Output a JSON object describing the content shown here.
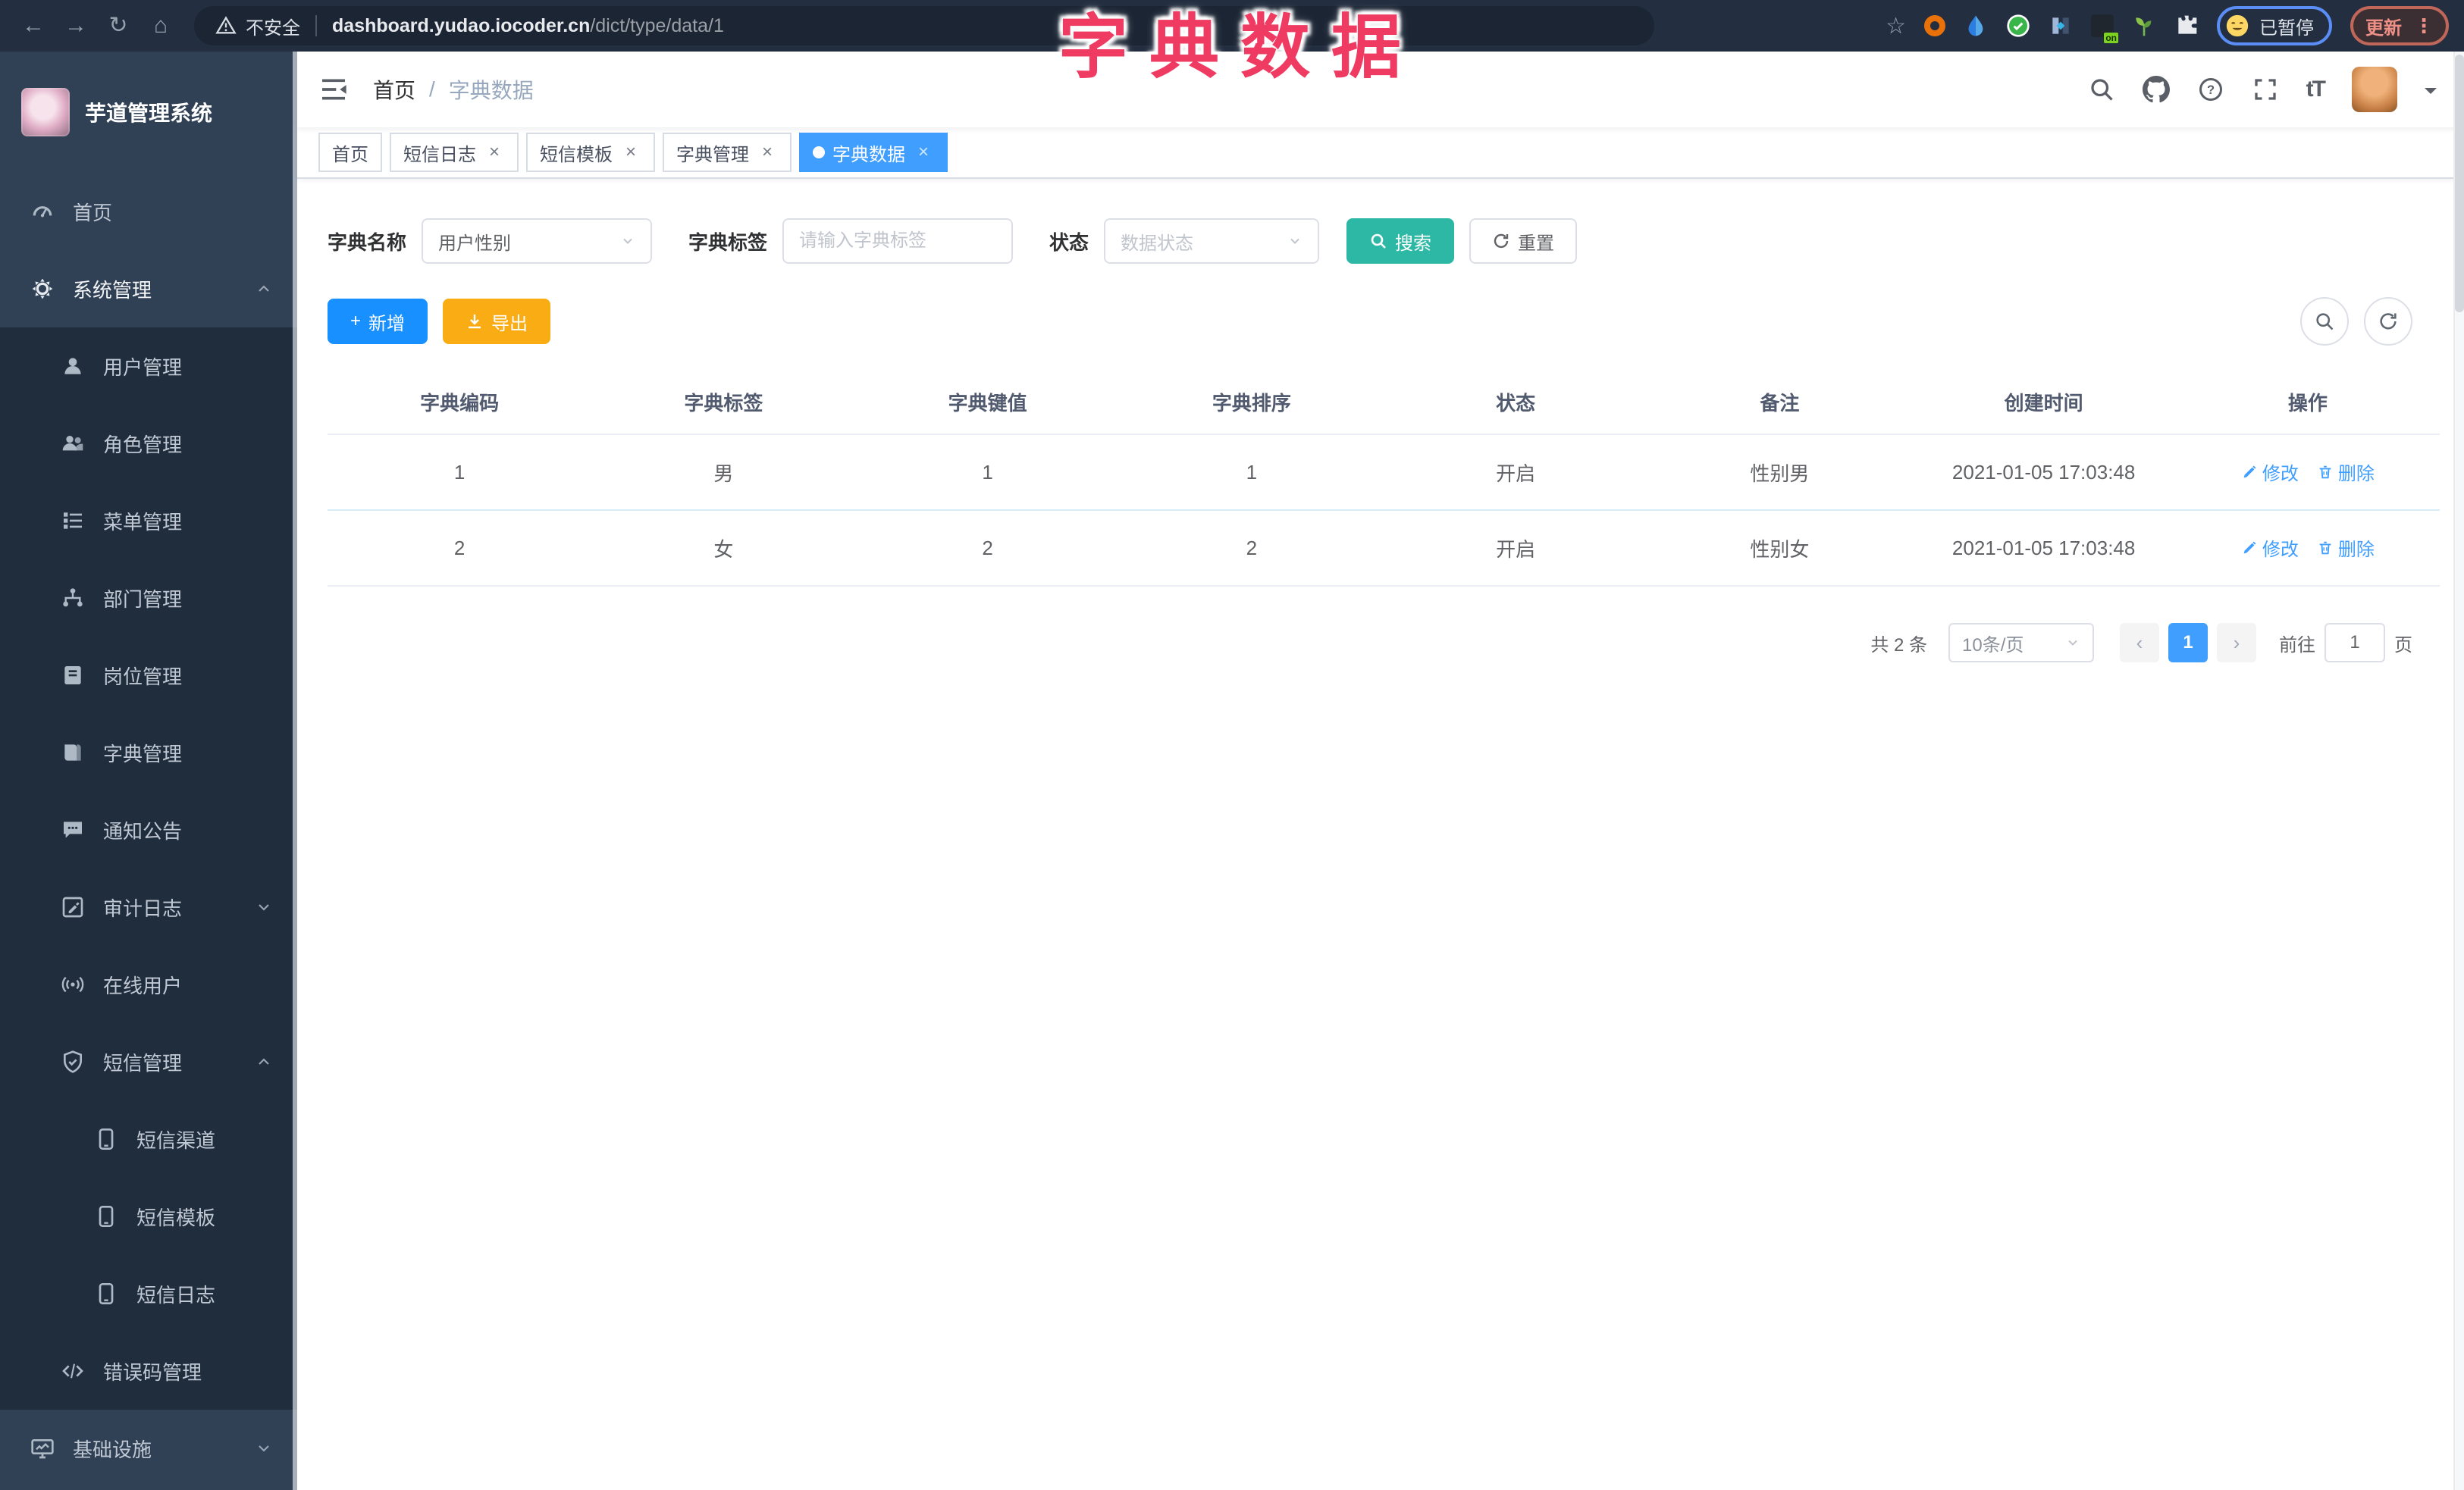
{
  "browser": {
    "security_label": "不安全",
    "url_host": "dashboard.yudao.iocoder.cn",
    "url_path": "/dict/type/data/1",
    "ext_badge_on": "on",
    "paused_label": "已暂停",
    "update_label": "更新"
  },
  "overlay_title": "字典数据",
  "sidebar": {
    "logo_title": "芋道管理系统",
    "items": [
      {
        "id": "home",
        "label": "首页",
        "icon": "dashboard-icon",
        "level": 1
      },
      {
        "id": "system-management",
        "label": "系统管理",
        "icon": "gear-icon",
        "level": 1,
        "active": true,
        "arrow": "up"
      },
      {
        "id": "user-management",
        "label": "用户管理",
        "icon": "user-icon",
        "level": 2
      },
      {
        "id": "role-management",
        "label": "角色管理",
        "icon": "users-icon",
        "level": 2
      },
      {
        "id": "menu-management",
        "label": "菜单管理",
        "icon": "menu-list-icon",
        "level": 2
      },
      {
        "id": "dept-management",
        "label": "部门管理",
        "icon": "org-tree-icon",
        "level": 2
      },
      {
        "id": "post-management",
        "label": "岗位管理",
        "icon": "badge-icon",
        "level": 2
      },
      {
        "id": "dict-management",
        "label": "字典管理",
        "icon": "book-icon",
        "level": 2
      },
      {
        "id": "notice-announcement",
        "label": "通知公告",
        "icon": "announcement-icon",
        "level": 2
      },
      {
        "id": "audit-log",
        "label": "审计日志",
        "icon": "log-icon",
        "level": 2,
        "arrow": "down"
      },
      {
        "id": "online-users",
        "label": "在线用户",
        "icon": "online-icon",
        "level": 2
      },
      {
        "id": "sms-management",
        "label": "短信管理",
        "icon": "shield-check-icon",
        "level": 2,
        "arrow": "up"
      },
      {
        "id": "sms-channel",
        "label": "短信渠道",
        "icon": "phone-icon",
        "level": 3
      },
      {
        "id": "sms-template",
        "label": "短信模板",
        "icon": "phone-icon",
        "level": 3
      },
      {
        "id": "sms-log",
        "label": "短信日志",
        "icon": "phone-icon",
        "level": 3
      },
      {
        "id": "error-code-management",
        "label": "错误码管理",
        "icon": "code-icon",
        "level": 2
      },
      {
        "id": "infrastructure",
        "label": "基础设施",
        "icon": "monitor-icon",
        "level": 1,
        "arrow": "down"
      }
    ]
  },
  "navbar": {
    "breadcrumb": {
      "home": "首页",
      "separator": "/",
      "current": "字典数据"
    },
    "font_size_icon": "tT"
  },
  "tabs": [
    {
      "label": "首页",
      "closable": false,
      "active": false
    },
    {
      "label": "短信日志",
      "closable": true,
      "active": false
    },
    {
      "label": "短信模板",
      "closable": true,
      "active": false
    },
    {
      "label": "字典管理",
      "closable": true,
      "active": false
    },
    {
      "label": "字典数据",
      "closable": true,
      "active": true
    }
  ],
  "filters": {
    "dict_name": {
      "label": "字典名称",
      "value": "用户性别"
    },
    "dict_label": {
      "label": "字典标签",
      "placeholder": "请输入字典标签"
    },
    "status": {
      "label": "状态",
      "placeholder": "数据状态"
    },
    "search_label": "搜索",
    "reset_label": "重置"
  },
  "toolbar": {
    "add_label": "新增",
    "export_label": "导出"
  },
  "table": {
    "columns": [
      "字典编码",
      "字典标签",
      "字典键值",
      "字典排序",
      "状态",
      "备注",
      "创建时间",
      "操作"
    ],
    "rows": [
      {
        "code": "1",
        "label": "男",
        "value": "1",
        "sort": "1",
        "status": "开启",
        "remark": "性别男",
        "created": "2021-01-05 17:03:48"
      },
      {
        "code": "2",
        "label": "女",
        "value": "2",
        "sort": "2",
        "status": "开启",
        "remark": "性别女",
        "created": "2021-01-05 17:03:48"
      }
    ],
    "actions": {
      "edit": "修改",
      "delete": "删除"
    }
  },
  "pagination": {
    "total": "共 2 条",
    "page_size": "10条/页",
    "current_page": "1",
    "goto_label": "前往",
    "goto_value": "1",
    "page_unit": "页"
  },
  "icons": {
    "search-icon": "magnifier",
    "github-icon": "octocat",
    "help-icon": "question-circle",
    "fullscreen-icon": "corner-brackets",
    "font-size-icon": "tT letters",
    "not-secure-warning-icon": "warning-triangle",
    "edit-icon": "pencil",
    "delete-icon": "trash-can",
    "refresh-icon": "circular-arrow"
  },
  "colors": {
    "primary_blue": "#409eff",
    "add_button_blue": "#1890ff",
    "export_button_orange": "#f9ac13",
    "search_button_teal": "#2db8a5",
    "sidebar_bg": "#304156",
    "sidebar_submenu_bg": "#1f2d3d",
    "overlay_title_pink": "#ef3b62",
    "link_blue": "#409eff"
  }
}
